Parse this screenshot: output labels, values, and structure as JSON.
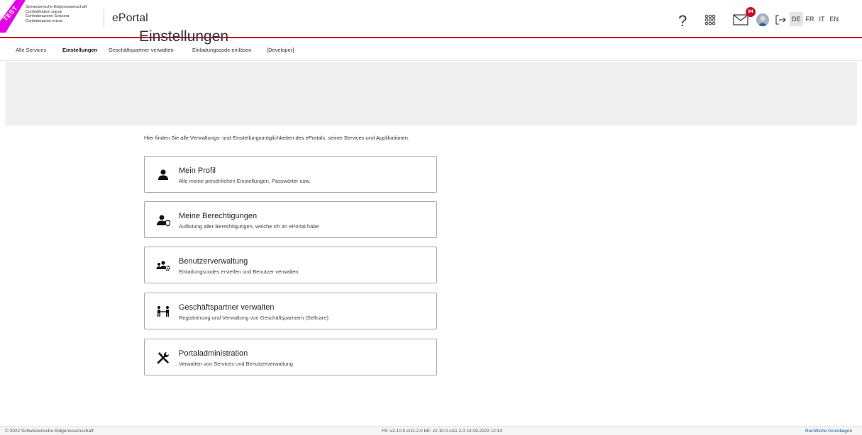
{
  "header": {
    "ribbon_label": "TEST",
    "logo_lines": [
      "Schweizerische Eidgenossenschaft",
      "Confédération suisse",
      "Confederazione Svizzera",
      "Confederaziun svizra"
    ],
    "app_title": "ePortal",
    "help_label": "?",
    "mail_badge_count": "94",
    "languages": [
      "DE",
      "FR",
      "IT",
      "EN"
    ],
    "active_language": "DE",
    "accent_color": "#c8102e"
  },
  "nav": {
    "items": [
      {
        "label": "Alle Services"
      },
      {
        "label": "Einstellungen"
      },
      {
        "label": "Geschäftspartner verwalten"
      },
      {
        "label": "Einladungscode einlösen"
      },
      {
        "label": "[Developer]"
      }
    ],
    "active": "Einstellungen"
  },
  "page": {
    "title": "Einstellungen",
    "intro": "Hier finden Sie alle Verwaltungs- und Einstellungsmöglichkeiten des ePortals, seiner Services und Applikationen."
  },
  "cards": [
    {
      "icon": "user-icon",
      "title": "Mein Profil",
      "desc": "Alle meine persönlichen Einstellungen, Passwörter usw."
    },
    {
      "icon": "user-shield-icon",
      "title": "Meine Berechtigungen",
      "desc": "Auflistung aller Berechtigungen, welche ich im ePortal habe"
    },
    {
      "icon": "users-gear-icon",
      "title": "Benutzerverwaltung",
      "desc": "Einladungscodes erstellen und Benutzer verwalten"
    },
    {
      "icon": "partners-icon",
      "title": "Geschäftspartner verwalten",
      "desc": "Registrierung und Verwaltung von Geschäftspartnern (Selfcare)"
    },
    {
      "icon": "tools-icon",
      "title": "Portaladministration",
      "desc": "Verwalten von Services und Benutzerverwaltung"
    }
  ],
  "footer": {
    "copyright": "© 2022 Schweizerische Eidgenossenschaft",
    "version": "FE: v2.10.0-ci11.2.0 BE: v2.10.0-ci11.2.0 14.09.2022 12:14",
    "legal_link": "Rechtliche Grundlagen"
  }
}
